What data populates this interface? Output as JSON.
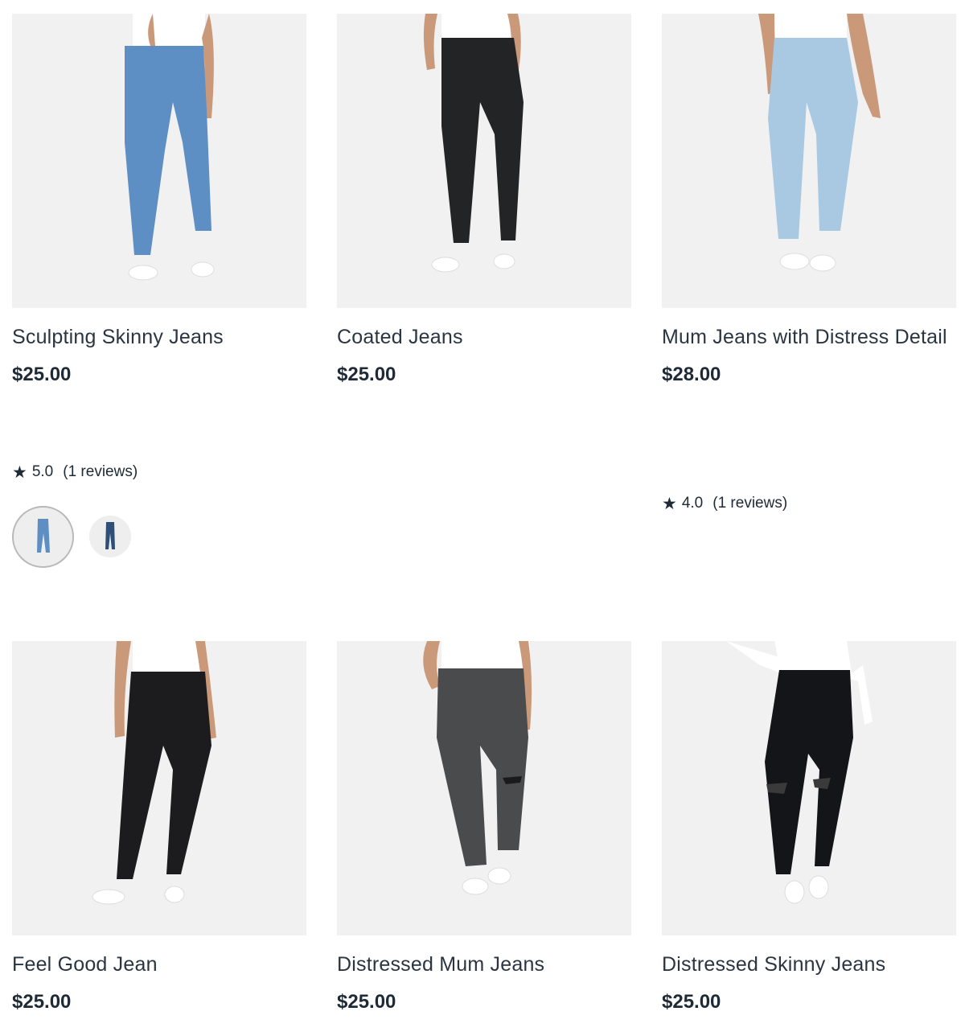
{
  "products": [
    {
      "title": "Sculpting Skinny Jeans",
      "price": "$25.00",
      "rating": "5.0",
      "reviews": "(1 reviews)",
      "image": "jeans-mid-blue-icon",
      "denim_color": "#5d8ec4"
    },
    {
      "title": "Coated Jeans",
      "price": "$25.00",
      "image": "jeans-black-coated-icon",
      "denim_color": "#222426"
    },
    {
      "title": "Mum Jeans with Distress Detail",
      "price": "$28.00",
      "rating": "4.0",
      "reviews": "(1 reviews)",
      "image": "jeans-light-blue-icon",
      "denim_color": "#a9c9e3"
    },
    {
      "title": "Feel Good Jean",
      "price": "$25.00",
      "image": "jeans-black-icon",
      "denim_color": "#1c1c1e"
    },
    {
      "title": "Distressed Mum Jeans",
      "price": "$25.00",
      "image": "jeans-charcoal-icon",
      "denim_color": "#4a4b4d"
    },
    {
      "title": "Distressed Skinny Jeans",
      "price": "$25.00",
      "image": "jeans-black-ripped-icon",
      "denim_color": "#141518"
    }
  ],
  "swatches": [
    {
      "name": "mid-blue",
      "color": "#5d8ec4",
      "selected": true
    },
    {
      "name": "dark-blue",
      "color": "#2e4f78",
      "selected": false
    }
  ],
  "colors": {
    "text": "#1e2a36",
    "image_bg": "#f1f1f1",
    "swatch_border": "#b8b8b8"
  }
}
